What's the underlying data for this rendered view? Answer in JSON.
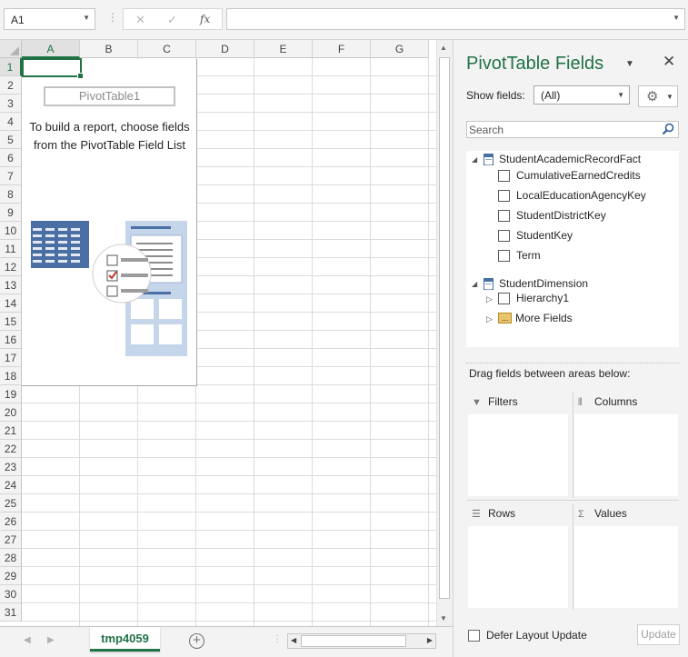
{
  "formula_bar": {
    "name_box": "A1",
    "cancel_icon": "✕",
    "enter_icon": "✓",
    "fx_icon": "fx",
    "formula": ""
  },
  "sheet": {
    "columns": [
      "A",
      "B",
      "C",
      "D",
      "E",
      "F",
      "G"
    ],
    "rows": [
      "1",
      "2",
      "3",
      "4",
      "5",
      "6",
      "7",
      "8",
      "9",
      "10",
      "11",
      "12",
      "13",
      "14",
      "15",
      "16",
      "17",
      "18",
      "19",
      "20",
      "21",
      "22",
      "23",
      "24",
      "25",
      "26",
      "27",
      "28",
      "29",
      "30",
      "31"
    ],
    "selected_cell": "A1",
    "pivot_placeholder": {
      "title": "PivotTable1",
      "instructions": "To build a report, choose fields from the PivotTable Field List"
    },
    "tab_name": "tmp4059",
    "add_sheet_icon": "+"
  },
  "pane": {
    "title": "PivotTable Fields",
    "close_icon": "✕",
    "show_fields_label": "Show fields:",
    "show_fields_value": "(All)",
    "search_placeholder": "Search",
    "tables": [
      {
        "name": "StudentAcademicRecordFact",
        "fields": [
          "CumulativeEarnedCredits",
          "LocalEducationAgencyKey",
          "StudentDistrictKey",
          "StudentKey",
          "Term"
        ]
      },
      {
        "name": "StudentDimension",
        "fields": [
          "Hierarchy1"
        ],
        "more": "More Fields"
      }
    ],
    "drag_label": "Drag fields between areas below:",
    "areas": {
      "filters": "Filters",
      "columns": "Columns",
      "rows": "Rows",
      "values": "Values"
    },
    "defer_label": "Defer Layout Update",
    "update_button": "Update"
  },
  "colors": {
    "accent": "#217346",
    "pivot_illustration": "#4a6fa5"
  }
}
